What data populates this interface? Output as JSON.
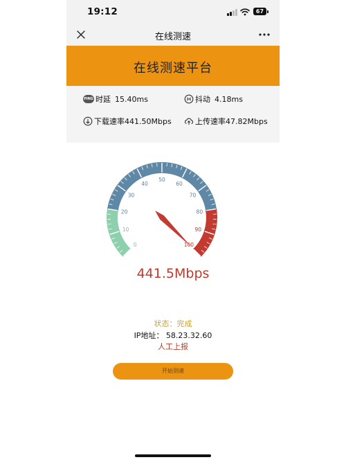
{
  "status_bar": {
    "time": "19:12",
    "battery": "67"
  },
  "nav": {
    "title": "在线测速"
  },
  "banner": {
    "title": "在线测速平台"
  },
  "metrics": {
    "latency": {
      "label": "时延",
      "value": "15.40ms",
      "badge": "PING"
    },
    "jitter": {
      "label": "抖动",
      "value": "4.18ms"
    },
    "download": {
      "label": "下载速率",
      "value": "441.50Mbps"
    },
    "upload": {
      "label": "上传速率",
      "value": "47.82Mbps"
    }
  },
  "gauge": {
    "ticks": [
      "0",
      "10",
      "20",
      "30",
      "40",
      "50",
      "60",
      "70",
      "80",
      "90",
      "100"
    ],
    "max": 100,
    "needle_value": 100,
    "colors": {
      "low": "#8ecfae",
      "mid": "#5f87a6",
      "high": "#c23a30",
      "needle": "#c23a30",
      "label_mid": "#5f7f9a",
      "label_high": "#c23a30",
      "label_low": "#8fb8a0"
    }
  },
  "result": {
    "speed": "441.5Mbps",
    "status": "状态：完成",
    "ip": "IP地址： 58.23.32.60",
    "report": "人工上报"
  },
  "actions": {
    "start": "开始测速"
  },
  "colors": {
    "accent": "#ec9412",
    "danger": "#c0392b",
    "status": "#d4a21c"
  }
}
